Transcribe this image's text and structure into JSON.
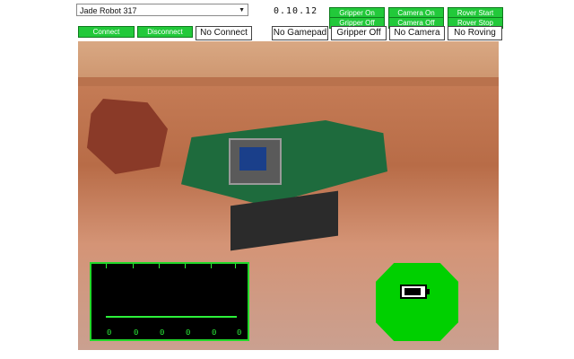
{
  "robot_select": {
    "selected": "Jade Robot 317",
    "arrow": "▼"
  },
  "version": "0.10.12",
  "buttons": {
    "connect": "Connect",
    "disconnect": "Disconnect",
    "gripper_on": "Gripper On",
    "gripper_off": "Gripper Off",
    "camera_on": "Camera On",
    "camera_off": "Camera Off",
    "rover_start": "Rover Start",
    "rover_stop": "Rover Stop"
  },
  "status": {
    "connect": "No Connect",
    "gamepad": "No Gamepad",
    "gripper": "Gripper Off",
    "camera": "No Camera",
    "roving": "No Roving"
  },
  "controller_readout": {
    "values": [
      "0",
      "0",
      "0",
      "0",
      "0",
      "0"
    ]
  },
  "colors": {
    "button_green": "#22c93a",
    "readout_green": "#2cf03a",
    "battery_panel": "#00d000"
  },
  "icons": {
    "battery": "battery-icon"
  }
}
